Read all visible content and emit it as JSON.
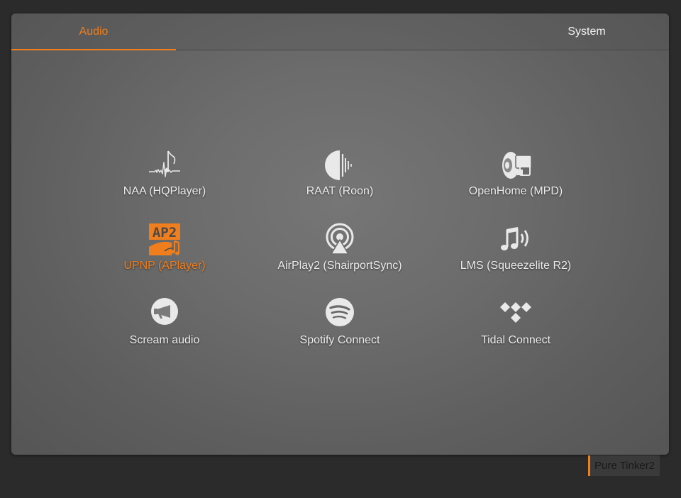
{
  "tabs": {
    "audio": "Audio",
    "system": "System"
  },
  "services": [
    {
      "label": "NAA (HQPlayer)",
      "icon": "naa-waveform-note-icon",
      "active": false
    },
    {
      "label": "RAAT (Roon)",
      "icon": "roon-raat-icon",
      "active": false
    },
    {
      "label": "OpenHome (MPD)",
      "icon": "openhome-speaker-icon",
      "active": false
    },
    {
      "label": "UPNP (APlayer)",
      "icon": "aplayer-ap2-icon",
      "active": true
    },
    {
      "label": "AirPlay2 (ShairportSync)",
      "icon": "airplay-icon",
      "active": false
    },
    {
      "label": "LMS (Squeezelite R2)",
      "icon": "music-note-sound-icon",
      "active": false
    },
    {
      "label": "Scream audio",
      "icon": "megaphone-icon",
      "active": false
    },
    {
      "label": "Spotify Connect",
      "icon": "spotify-icon",
      "active": false
    },
    {
      "label": "Tidal Connect",
      "icon": "tidal-icon",
      "active": false
    }
  ],
  "footer": {
    "brand": "Pure Tinker2"
  },
  "colors": {
    "accent": "#f07e1d",
    "icon": "#e9e9e9",
    "background": "#2b2b2b"
  }
}
